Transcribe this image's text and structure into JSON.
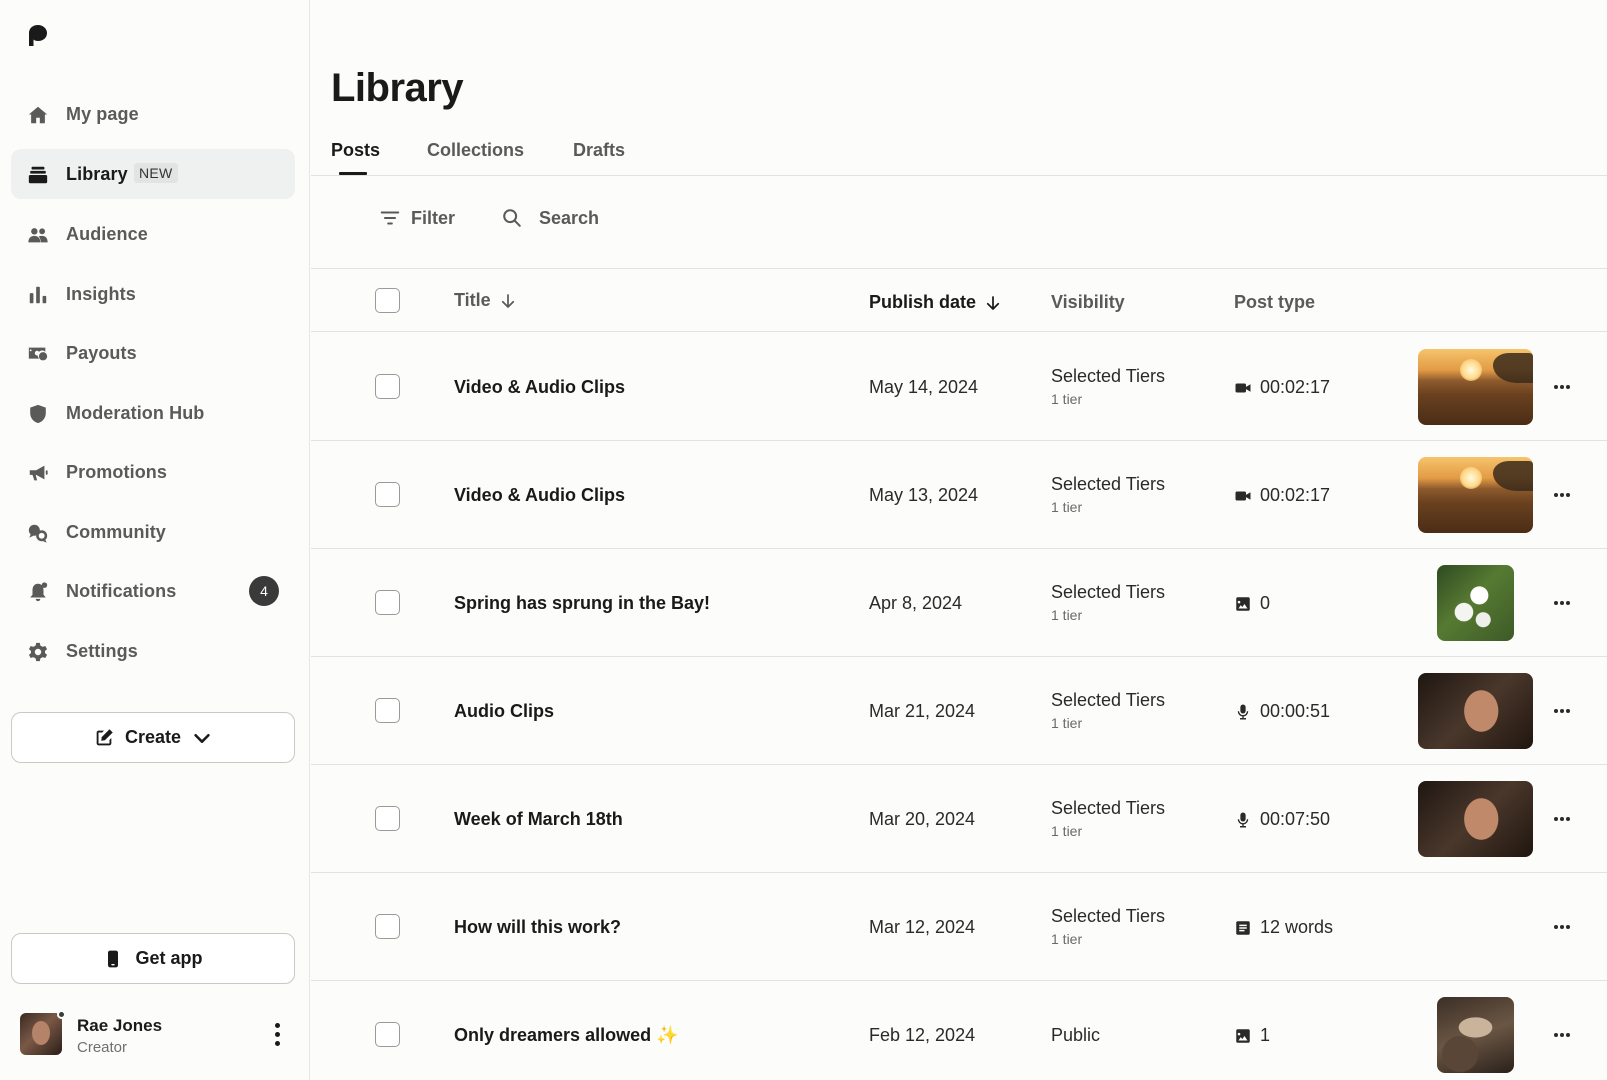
{
  "sidebar": {
    "items": [
      {
        "label": "My page",
        "icon": "home-icon"
      },
      {
        "label": "Library",
        "icon": "library-icon",
        "badge": "NEW",
        "active": true
      },
      {
        "label": "Audience",
        "icon": "audience-icon"
      },
      {
        "label": "Insights",
        "icon": "insights-icon"
      },
      {
        "label": "Payouts",
        "icon": "payouts-icon"
      },
      {
        "label": "Moderation Hub",
        "icon": "shield-icon"
      },
      {
        "label": "Promotions",
        "icon": "megaphone-icon"
      },
      {
        "label": "Community",
        "icon": "community-icon"
      },
      {
        "label": "Notifications",
        "icon": "bell-icon",
        "count": "4"
      },
      {
        "label": "Settings",
        "icon": "gear-icon"
      }
    ],
    "create_label": "Create",
    "get_app_label": "Get app",
    "user": {
      "name": "Rae Jones",
      "role": "Creator"
    }
  },
  "main": {
    "title": "Library",
    "tabs": [
      {
        "label": "Posts",
        "active": true
      },
      {
        "label": "Collections"
      },
      {
        "label": "Drafts"
      }
    ],
    "toolbar": {
      "filter_label": "Filter",
      "search_label": "Search"
    },
    "columns": {
      "title": "Title",
      "publish_date": "Publish date",
      "visibility": "Visibility",
      "post_type": "Post type"
    },
    "rows": [
      {
        "title": "Video & Audio Clips",
        "date": "May 14, 2024",
        "visibility": "Selected Tiers",
        "tiers": "1 tier",
        "type_icon": "video-icon",
        "type_value": "00:02:17",
        "thumb": "beach"
      },
      {
        "title": "Video & Audio Clips",
        "date": "May 13, 2024",
        "visibility": "Selected Tiers",
        "tiers": "1 tier",
        "type_icon": "video-icon",
        "type_value": "00:02:17",
        "thumb": "beach"
      },
      {
        "title": "Spring has sprung in the Bay!",
        "date": "Apr 8, 2024",
        "visibility": "Selected Tiers",
        "tiers": "1 tier",
        "type_icon": "image-icon",
        "type_value": "0",
        "thumb": "flowers"
      },
      {
        "title": "Audio Clips",
        "date": "Mar 21, 2024",
        "visibility": "Selected Tiers",
        "tiers": "1 tier",
        "type_icon": "mic-icon",
        "type_value": "00:00:51",
        "thumb": "portrait"
      },
      {
        "title": "Week of March 18th",
        "date": "Mar 20, 2024",
        "visibility": "Selected Tiers",
        "tiers": "1 tier",
        "type_icon": "mic-icon",
        "type_value": "00:07:50",
        "thumb": "portrait"
      },
      {
        "title": "How will this work?",
        "date": "Mar 12, 2024",
        "visibility": "Selected Tiers",
        "tiers": "1 tier",
        "type_icon": "text-icon",
        "type_value": "12 words",
        "thumb": ""
      },
      {
        "title": "Only dreamers allowed",
        "title_suffix": "✨",
        "date": "Feb 12, 2024",
        "visibility": "Public",
        "tiers": "",
        "type_icon": "image-icon",
        "type_value": "1",
        "thumb": "dreamer"
      }
    ]
  }
}
